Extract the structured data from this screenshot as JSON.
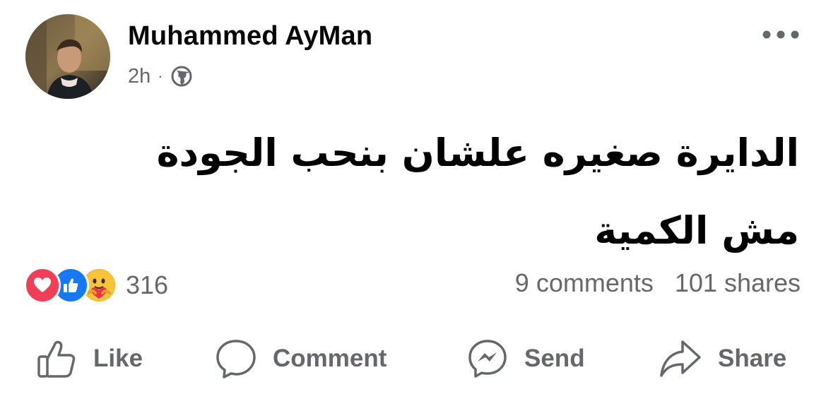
{
  "post": {
    "author": "Muhammed AyMan",
    "time": "2h",
    "separator": "·",
    "audience_icon": "globe-icon",
    "more_icon": "more-dots-icon",
    "text_lines": [
      "الدايرة صغيره علشان بنحب الجودة",
      "مش الكمية"
    ]
  },
  "reactions": {
    "icons": [
      "love-reaction",
      "like-reaction",
      "care-reaction"
    ],
    "count": "316",
    "comments": "9 comments",
    "shares": "101 shares"
  },
  "actions": {
    "like": "Like",
    "comment": "Comment",
    "send": "Send",
    "share": "Share"
  },
  "colors": {
    "love": "#f33e58",
    "like": "#1877f2",
    "care": "#f7b125",
    "muted": "#65676b",
    "text": "#050505"
  }
}
